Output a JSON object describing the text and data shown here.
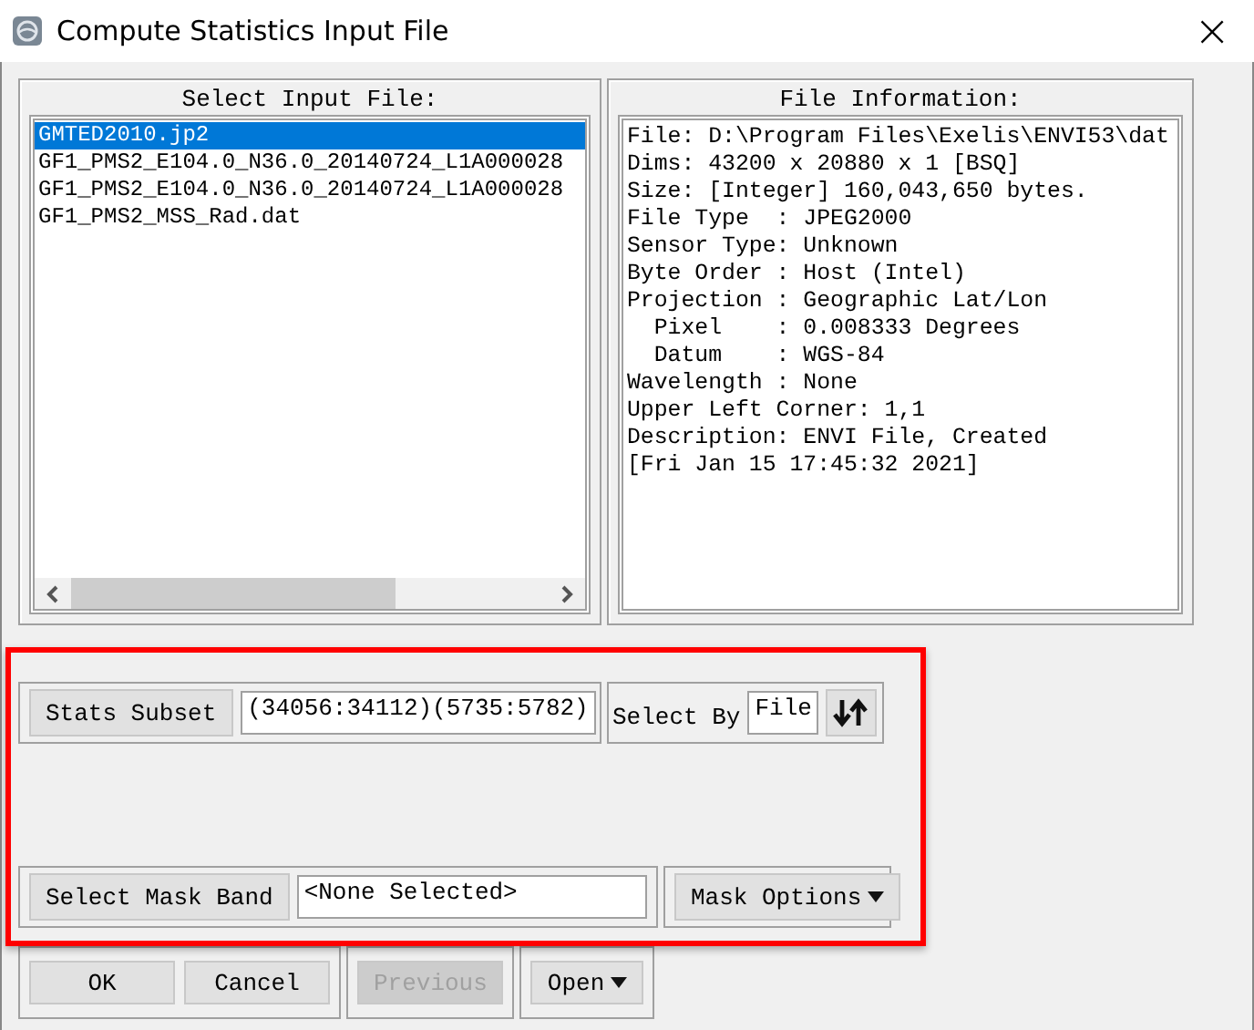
{
  "window": {
    "title": "Compute Statistics Input File",
    "close": "×"
  },
  "input_files": {
    "label": "Select Input File:",
    "items": [
      {
        "name": "GMTED2010.jp2",
        "selected": true
      },
      {
        "name": "GF1_PMS2_E104.0_N36.0_20140724_L1A000028",
        "selected": false
      },
      {
        "name": "GF1_PMS2_E104.0_N36.0_20140724_L1A000028",
        "selected": false
      },
      {
        "name": "GF1_PMS2_MSS_Rad.dat",
        "selected": false
      }
    ]
  },
  "file_information": {
    "label": "File Information:",
    "lines": [
      "File: D:\\Program Files\\Exelis\\ENVI53\\dat",
      "Dims: 43200 x 20880 x 1 [BSQ]",
      "Size: [Integer] 160,043,650 bytes.",
      "File Type  : JPEG2000",
      "Sensor Type: Unknown",
      "Byte Order : Host (Intel)",
      "Projection : Geographic Lat/Lon",
      "  Pixel    : 0.008333 Degrees",
      "  Datum    : WGS-84",
      "Wavelength : None",
      "Upper Left Corner: 1,1",
      "Description: ENVI File, Created",
      "[Fri Jan 15 17:45:32 2021]"
    ]
  },
  "stats_subset": {
    "button": "Stats Subset",
    "value": "(34056:34112)(5735:5782)"
  },
  "select_by": {
    "label": "Select By",
    "value": "File"
  },
  "mask": {
    "button": "Select Mask Band",
    "value": "<None Selected>",
    "options": "Mask Options"
  },
  "button_groups": [
    [
      {
        "label": "OK",
        "disabled": false,
        "menu": false
      },
      {
        "label": "Cancel",
        "disabled": false,
        "menu": false
      }
    ],
    [
      {
        "label": "Previous",
        "disabled": true,
        "menu": false
      }
    ],
    [
      {
        "label": "Open",
        "disabled": false,
        "menu": true
      }
    ]
  ]
}
